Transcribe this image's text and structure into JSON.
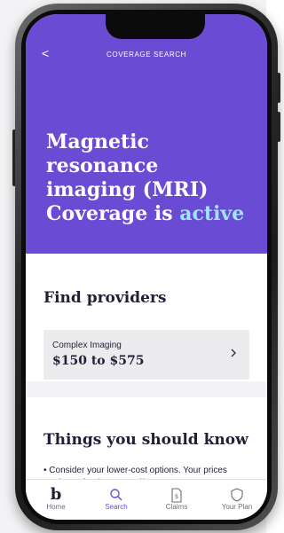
{
  "header": {
    "back_glyph": "<",
    "title": "COVERAGE SEARCH"
  },
  "hero": {
    "line1": "Magnetic resonance",
    "line2": "imaging (MRI)",
    "line3_prefix": "Coverage is",
    "status_word": "active",
    "accent_color": "#9fe3ff",
    "background_color": "#6a4bd4"
  },
  "find_providers": {
    "heading": "Find providers",
    "item": {
      "name": "Complex Imaging",
      "price_range": "$150 to $575",
      "chevron_icon": "chevron-right-icon"
    }
  },
  "things_to_know": {
    "heading": "Things you should know",
    "bullets": [
      "Consider your lower-cost options. Your prices are lower for doctors and/or"
    ]
  },
  "tabbar": {
    "active_color": "#6a4bd4",
    "tabs": [
      {
        "label": "Home",
        "icon": "logo-b-icon",
        "active": false
      },
      {
        "label": "Search",
        "icon": "search-icon",
        "active": true
      },
      {
        "label": "Claims",
        "icon": "receipt-dollar-icon",
        "active": false
      },
      {
        "label": "Your Plan",
        "icon": "shield-icon",
        "active": false
      }
    ]
  }
}
